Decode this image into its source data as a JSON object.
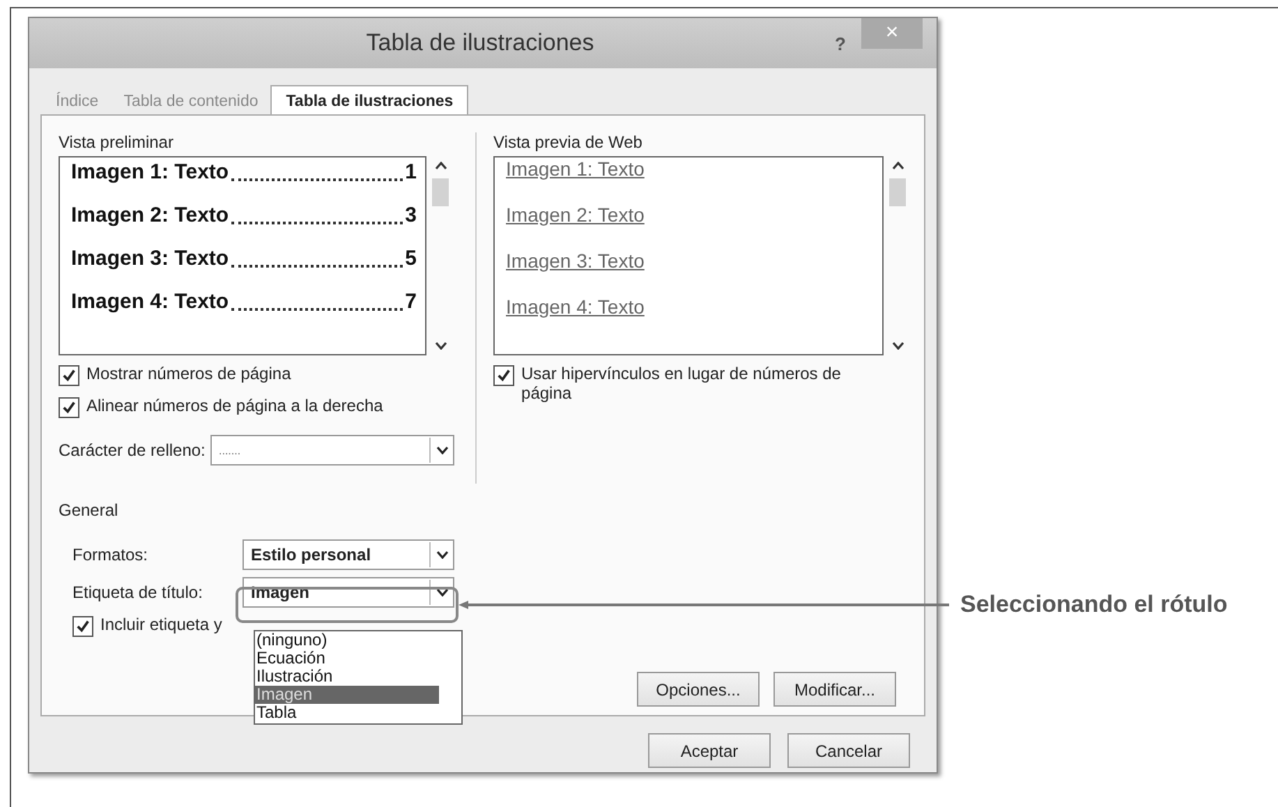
{
  "window": {
    "title": "Tabla de ilustraciones",
    "help_button": "?",
    "close_button": "×"
  },
  "tabs": [
    {
      "label": "Índice",
      "selected": false
    },
    {
      "label": "Tabla de contenido",
      "selected": false
    },
    {
      "label": "Tabla de ilustraciones",
      "selected": true
    }
  ],
  "print_preview": {
    "label": "Vista preliminar",
    "items": [
      {
        "caption": "Imagen 1: Texto",
        "page": "1"
      },
      {
        "caption": "Imagen 2: Texto",
        "page": "3"
      },
      {
        "caption": "Imagen 3: Texto",
        "page": "5"
      },
      {
        "caption": "Imagen 4: Texto",
        "page": "7"
      }
    ]
  },
  "print_options": [
    {
      "label": "Mostrar números de página",
      "checked": true
    },
    {
      "label": "Alinear números de página a la derecha",
      "checked": true
    }
  ],
  "tab_leader": {
    "label": "Carácter de relleno:",
    "value": "......."
  },
  "web_preview": {
    "label": "Vista previa de Web",
    "items": [
      "Imagen 1: Texto",
      "Imagen 2: Texto",
      "Imagen 3: Texto",
      "Imagen 4: Texto"
    ]
  },
  "web_options": [
    {
      "label": "Usar hipervínculos en lugar de números de página",
      "checked": true
    }
  ],
  "general": {
    "label": "General",
    "formats": {
      "label": "Formatos:",
      "value": "Estilo personal"
    },
    "caption_label": {
      "label": "Etiqueta de título:",
      "value": "Imagen"
    },
    "include": {
      "label": "Incluir etiqueta y",
      "checked": true
    }
  },
  "caption_dropdown": [
    {
      "label": "(ninguno)",
      "selected": false
    },
    {
      "label": "Ecuación",
      "selected": false
    },
    {
      "label": "Ilustración",
      "selected": false
    },
    {
      "label": "Imagen",
      "selected": true
    },
    {
      "label": "Tabla",
      "selected": false
    }
  ],
  "panel_buttons": [
    "Opciones...",
    "Modificar..."
  ],
  "footer_buttons": [
    "Aceptar",
    "Cancelar"
  ],
  "callout": {
    "text": "Seleccionando el rótulo"
  }
}
